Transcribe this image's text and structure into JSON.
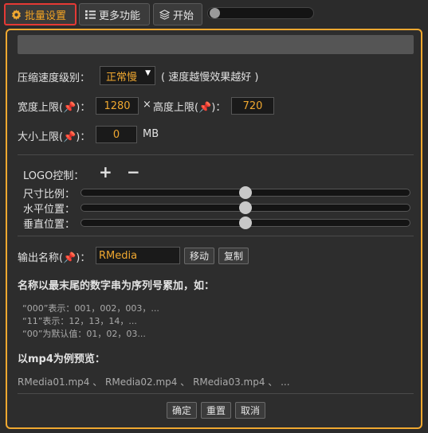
{
  "toolbar": {
    "batch_settings": "批量设置",
    "more_functions": "更多功能",
    "start": "开始"
  },
  "compression": {
    "label": "压缩速度级别：",
    "selected": "正常慢",
    "hint": "( 速度越慢效果越好 )"
  },
  "dimensions": {
    "width_label": "宽度上限(",
    "width_value": "1280",
    "times": "×",
    "height_label": "高度上限(",
    "height_value": "720",
    "close_colon": ")："
  },
  "size": {
    "label": "大小上限(",
    "value": "0",
    "unit": "MB"
  },
  "logo": {
    "label": "LOGO控制：",
    "add": "+",
    "remove": "−",
    "sliders": [
      {
        "label": "尺寸比例：",
        "value": 0.5
      },
      {
        "label": "水平位置：",
        "value": 0.5
      },
      {
        "label": "垂直位置：",
        "value": 0.5
      }
    ]
  },
  "output": {
    "label": "输出名称(",
    "value": "RMedia",
    "move": "移动",
    "copy": "复制",
    "rule": "名称以最末尾的数字串为序列号累加，如：",
    "ex1": "“000”表示：001，002，003，...",
    "ex2": "“11”表示：12，13，14，...",
    "ex3": "“00”为默认值：01，02，03...",
    "preview_title": "以mp4为例预览：",
    "preview": "RMedia01.mp4 、 RMedia02.mp4 、 RMedia03.mp4 、 ..."
  },
  "footer": {
    "ok": "确定",
    "reset": "重置",
    "cancel": "取消"
  },
  "colors": {
    "accent": "#f0a830",
    "active_border": "#e53935",
    "background": "#2b2b2b"
  }
}
